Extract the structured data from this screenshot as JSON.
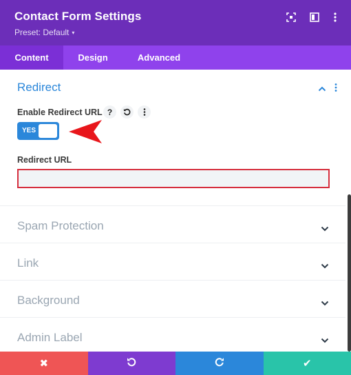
{
  "header": {
    "title": "Contact Form Settings",
    "preset": "Preset: Default",
    "icons": [
      "focus-icon",
      "split-view-icon",
      "more-vertical-icon"
    ]
  },
  "tabs": [
    {
      "label": "Content",
      "active": true
    },
    {
      "label": "Design",
      "active": false
    },
    {
      "label": "Advanced",
      "active": false
    }
  ],
  "redirect": {
    "title": "Redirect",
    "enable_label": "Enable Redirect URL",
    "help_glyph": "?",
    "toggle_text": "YES",
    "toggle_on": true,
    "url_label": "Redirect URL",
    "url_value": ""
  },
  "sections": [
    {
      "label": "Spam Protection"
    },
    {
      "label": "Link"
    },
    {
      "label": "Background"
    },
    {
      "label": "Admin Label"
    }
  ],
  "bottom_bar": {
    "cancel_glyph": "✖",
    "undo_icon": "undo-icon",
    "redo_icon": "redo-icon",
    "save_glyph": "✔"
  },
  "colors": {
    "header": "#6c2eb9",
    "tabs": "#8f42ec",
    "active_tab": "#7b2fd6",
    "accent_blue": "#2b87da",
    "cancel": "#ef5555",
    "undo": "#7e3bd0",
    "redo": "#2b87da",
    "save": "#29c4a9",
    "annotation_arrow": "#e8161b",
    "input_border": "#d62e3d"
  }
}
